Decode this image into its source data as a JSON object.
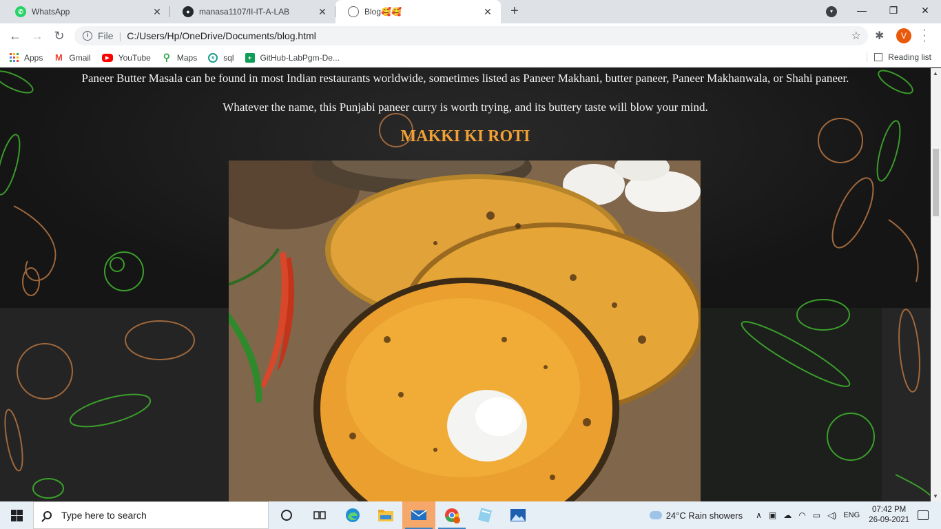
{
  "tabs": [
    {
      "title": "WhatsApp",
      "icon": "whatsapp-icon"
    },
    {
      "title": "manasa1107/II-IT-A-LAB",
      "icon": "github-icon"
    },
    {
      "title": "Blog🥰🥰",
      "icon": "globe-icon"
    }
  ],
  "window": {
    "minimize": "—",
    "restore": "❐",
    "close": "✕"
  },
  "toolbar": {
    "scheme": "File",
    "url": "C:/Users/Hp/OneDrive/Documents/blog.html",
    "profile_initial": "V"
  },
  "bookmarks": [
    {
      "label": "Apps",
      "icon": "apps-grid-icon"
    },
    {
      "label": "Gmail",
      "icon": "gmail-icon",
      "color": "#ea4335"
    },
    {
      "label": "YouTube",
      "icon": "youtube-icon",
      "color": "#ff0000"
    },
    {
      "label": "Maps",
      "icon": "maps-icon",
      "color": "#34a853"
    },
    {
      "label": "sql",
      "icon": "sql-icon",
      "color": "#1a9e8f"
    },
    {
      "label": "GitHub-LabPgm-De...",
      "icon": "github-labpgm-icon",
      "color": "#0f9d58"
    }
  ],
  "reading_list": "Reading list",
  "page": {
    "para1": "Paneer Butter Masala can be found in most Indian restaurants worldwide, sometimes listed as Paneer Makhani, butter paneer, Paneer Makhanwala, or Shahi paneer.",
    "para2": "Whatever the name, this Punjabi paneer curry is worth trying, and its buttery taste will blow your mind.",
    "heading": "MAKKI KI ROTI",
    "heading_color": "#f0a035"
  },
  "taskbar": {
    "search_placeholder": "Type here to search",
    "weather": "24°C  Rain showers",
    "language": "ENG",
    "time": "07:42 PM",
    "date": "26-09-2021"
  }
}
